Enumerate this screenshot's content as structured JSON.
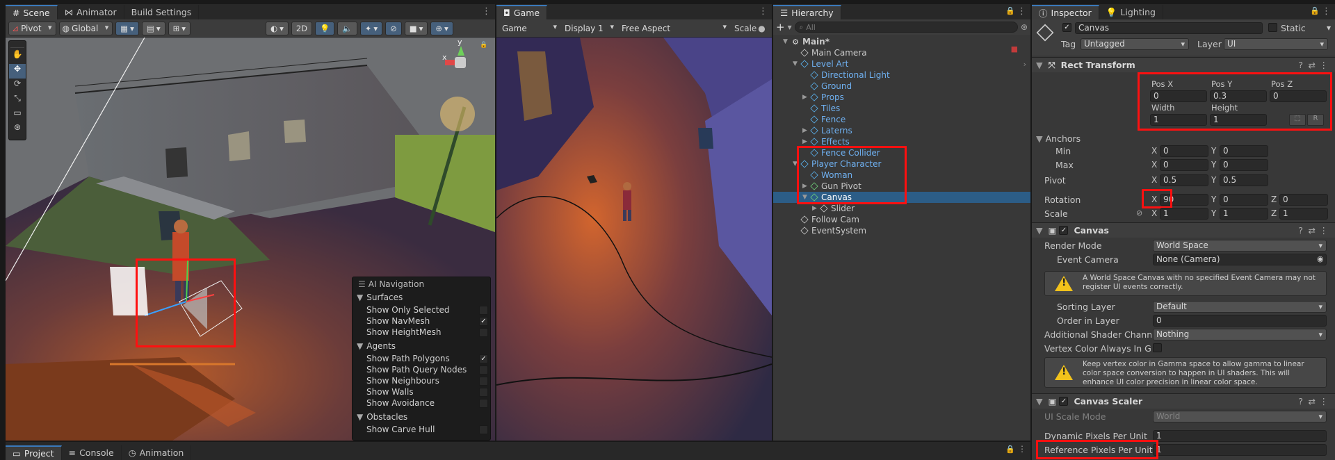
{
  "scene": {
    "tabs": [
      "Scene",
      "Animator",
      "Build Settings"
    ],
    "toolbar": {
      "pivot": "Pivot",
      "global": "Global",
      "mode_2d": "2D"
    },
    "ai_nav": {
      "title": "AI Navigation",
      "sections": [
        {
          "name": "Surfaces",
          "items": [
            {
              "label": "Show Only Selected",
              "checked": false
            },
            {
              "label": "Show NavMesh",
              "checked": true
            },
            {
              "label": "Show HeightMesh",
              "checked": false
            }
          ]
        },
        {
          "name": "Agents",
          "items": [
            {
              "label": "Show Path Polygons",
              "checked": true
            },
            {
              "label": "Show Path Query Nodes",
              "checked": false
            },
            {
              "label": "Show Neighbours",
              "checked": false
            },
            {
              "label": "Show Walls",
              "checked": false
            },
            {
              "label": "Show Avoidance",
              "checked": false
            }
          ]
        },
        {
          "name": "Obstacles",
          "items": [
            {
              "label": "Show Carve Hull",
              "checked": false
            }
          ]
        }
      ]
    },
    "gizmo_axes": {
      "x": "x",
      "y": "y"
    }
  },
  "game": {
    "tab": "Game",
    "toolbar": {
      "view": "Game",
      "display": "Display 1",
      "aspect": "Free Aspect",
      "scale": "Scale"
    }
  },
  "hierarchy": {
    "tab": "Hierarchy",
    "search_placeholder": "All",
    "items": [
      {
        "label": "Main*",
        "indent": 0,
        "kind": "scene",
        "arrow": "open"
      },
      {
        "label": "Main Camera",
        "indent": 1,
        "kind": "white"
      },
      {
        "label": "Level Art",
        "indent": 1,
        "kind": "blue",
        "arrow": "open"
      },
      {
        "label": "Directional Light",
        "indent": 2,
        "kind": "blue"
      },
      {
        "label": "Ground",
        "indent": 2,
        "kind": "blue"
      },
      {
        "label": "Props",
        "indent": 2,
        "kind": "blue",
        "arrow": "closed"
      },
      {
        "label": "Tiles",
        "indent": 2,
        "kind": "blue"
      },
      {
        "label": "Fence",
        "indent": 2,
        "kind": "blue"
      },
      {
        "label": "Laterns",
        "indent": 2,
        "kind": "blue",
        "arrow": "closed"
      },
      {
        "label": "Effects",
        "indent": 2,
        "kind": "blue",
        "arrow": "closed"
      },
      {
        "label": "Fence Collider",
        "indent": 2,
        "kind": "blue"
      },
      {
        "label": "Player Character",
        "indent": 1,
        "kind": "blue",
        "arrow": "open"
      },
      {
        "label": "Woman",
        "indent": 2,
        "kind": "blue"
      },
      {
        "label": "Gun Pivot",
        "indent": 2,
        "kind": "green",
        "arrow": "closed"
      },
      {
        "label": "Canvas",
        "indent": 2,
        "kind": "green",
        "arrow": "open",
        "selected": true
      },
      {
        "label": "Slider",
        "indent": 3,
        "kind": "white",
        "arrow": "closed"
      },
      {
        "label": "Follow Cam",
        "indent": 1,
        "kind": "white"
      },
      {
        "label": "EventSystem",
        "indent": 1,
        "kind": "white"
      }
    ]
  },
  "inspector": {
    "tabs": [
      "Inspector",
      "Lighting"
    ],
    "object_name": "Canvas",
    "static_label": "Static",
    "tag_label": "Tag",
    "tag_value": "Untagged",
    "layer_label": "Layer",
    "layer_value": "UI",
    "rect_transform": {
      "title": "Rect Transform",
      "pos_x_label": "Pos X",
      "pos_y_label": "Pos Y",
      "pos_z_label": "Pos Z",
      "pos_x": "0",
      "pos_y": "0.3",
      "pos_z": "0",
      "width_label": "Width",
      "height_label": "Height",
      "width": "1",
      "height": "1",
      "r_button": "R",
      "anchors_label": "Anchors",
      "min_label": "Min",
      "max_label": "Max",
      "min_x": "0",
      "min_y": "0",
      "max_x": "0",
      "max_y": "0",
      "pivot_label": "Pivot",
      "pivot_x": "0.5",
      "pivot_y": "0.5",
      "rotation_label": "Rotation",
      "rot_x": "90",
      "rot_y": "0",
      "rot_z": "0",
      "scale_label": "Scale",
      "scale_x": "1",
      "scale_y": "1",
      "scale_z": "1",
      "x": "X",
      "y": "Y",
      "z": "Z"
    },
    "canvas": {
      "title": "Canvas",
      "render_mode_label": "Render Mode",
      "render_mode": "World Space",
      "event_camera_label": "Event Camera",
      "event_camera": "None (Camera)",
      "warning1": "A World Space Canvas with no specified Event Camera may not register UI events correctly.",
      "sorting_layer_label": "Sorting Layer",
      "sorting_layer": "Default",
      "order_label": "Order in Layer",
      "order": "0",
      "shader_channels_label": "Additional Shader Channels",
      "shader_channels": "Nothing",
      "vertex_color_label": "Vertex Color Always In Gamma",
      "warning2": "Keep vertex color in Gamma space to allow gamma to linear color space conversion to happen in UI shaders. This will enhance UI color precision in linear color space."
    },
    "canvas_scaler": {
      "title": "Canvas Scaler",
      "ui_scale_label": "UI Scale Mode",
      "ui_scale": "World",
      "dynamic_label": "Dynamic Pixels Per Unit",
      "dynamic": "1",
      "reference_label": "Reference Pixels Per Unit",
      "reference": "1"
    }
  },
  "bottom": {
    "tabs": [
      "Project",
      "Console",
      "Animation"
    ]
  },
  "colors": {
    "accent": "#3a79bb",
    "highlight": "#ff1010",
    "selection": "#2c5d87"
  }
}
